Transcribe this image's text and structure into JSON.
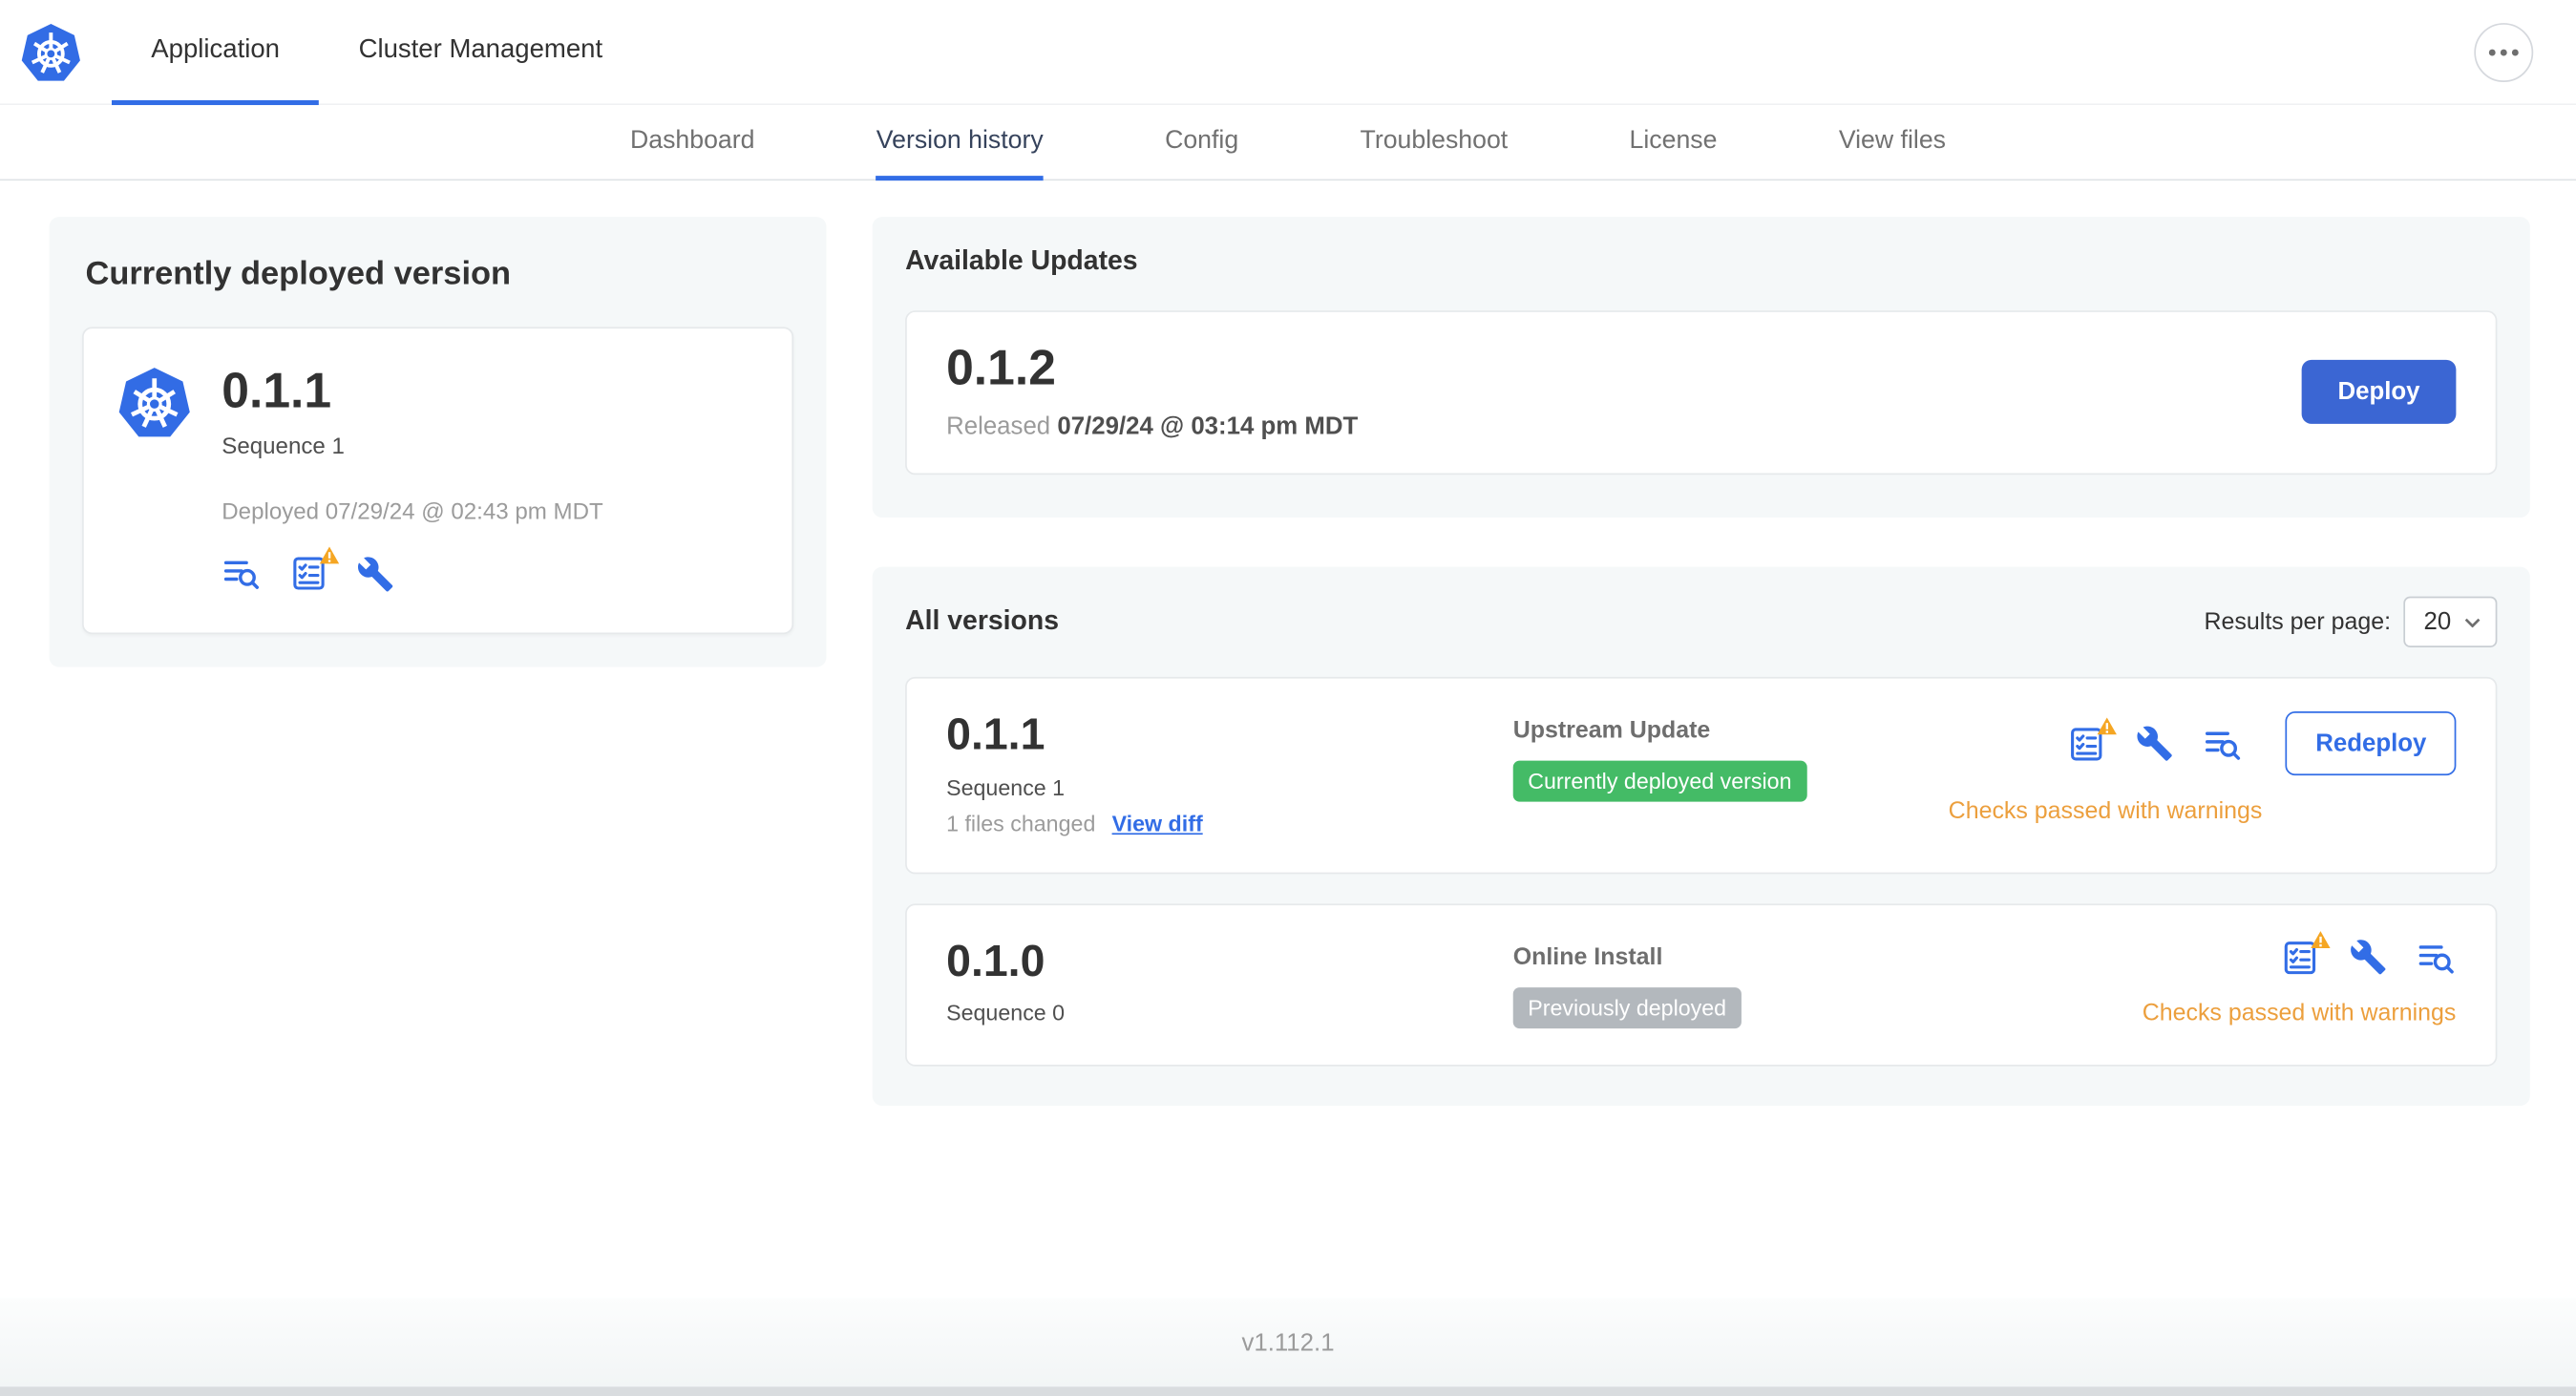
{
  "header": {
    "tabs": [
      "Application",
      "Cluster Management"
    ],
    "active_tab": "Application"
  },
  "subnav": {
    "items": [
      "Dashboard",
      "Version history",
      "Config",
      "Troubleshoot",
      "License",
      "View files"
    ],
    "active": "Version history"
  },
  "deployed": {
    "title": "Currently deployed version",
    "version": "0.1.1",
    "sequence": "Sequence 1",
    "deployed_at": "Deployed 07/29/24 @ 02:43 pm MDT"
  },
  "available_updates": {
    "title": "Available Updates",
    "version": "0.1.2",
    "released_prefix": "Released",
    "released_date": "07/29/24 @ 03:14 pm MDT",
    "deploy_label": "Deploy"
  },
  "all_versions": {
    "title": "All versions",
    "results_per_page_label": "Results per page:",
    "results_per_page_value": "20",
    "rows": [
      {
        "version": "0.1.1",
        "sequence": "Sequence 1",
        "files_changed": "1 files changed",
        "view_diff_label": "View diff",
        "source": "Upstream Update",
        "badge": "Currently deployed version",
        "badge_color": "#44bb66",
        "status": "Checks passed with warnings",
        "action_label": "Redeploy"
      },
      {
        "version": "0.1.0",
        "sequence": "Sequence 0",
        "source": "Online Install",
        "badge": "Previously deployed",
        "badge_color": "#b3b8bd",
        "status": "Checks passed with warnings"
      }
    ]
  },
  "footer": {
    "app_version": "v1.112.1"
  },
  "icons": {
    "logo": "kubernetes-logo",
    "header_more": "ellipsis-icon",
    "deployed_card_icons": [
      "logs-icon",
      "preflight-checks-warning-icon",
      "config-icon"
    ],
    "row_icons": [
      "preflight-checks-warning-icon",
      "config-icon",
      "logs-icon"
    ],
    "select_chevron": "chevron-down-icon"
  },
  "colors": {
    "accent": "#326de6",
    "primary_button": "#3b66d3",
    "success_badge": "#44bb66",
    "neutral_badge": "#b3b8bd",
    "warning_text": "#ec9f3d",
    "warning_triangle": "#f5a623",
    "logo_blue": "#326ce5"
  }
}
